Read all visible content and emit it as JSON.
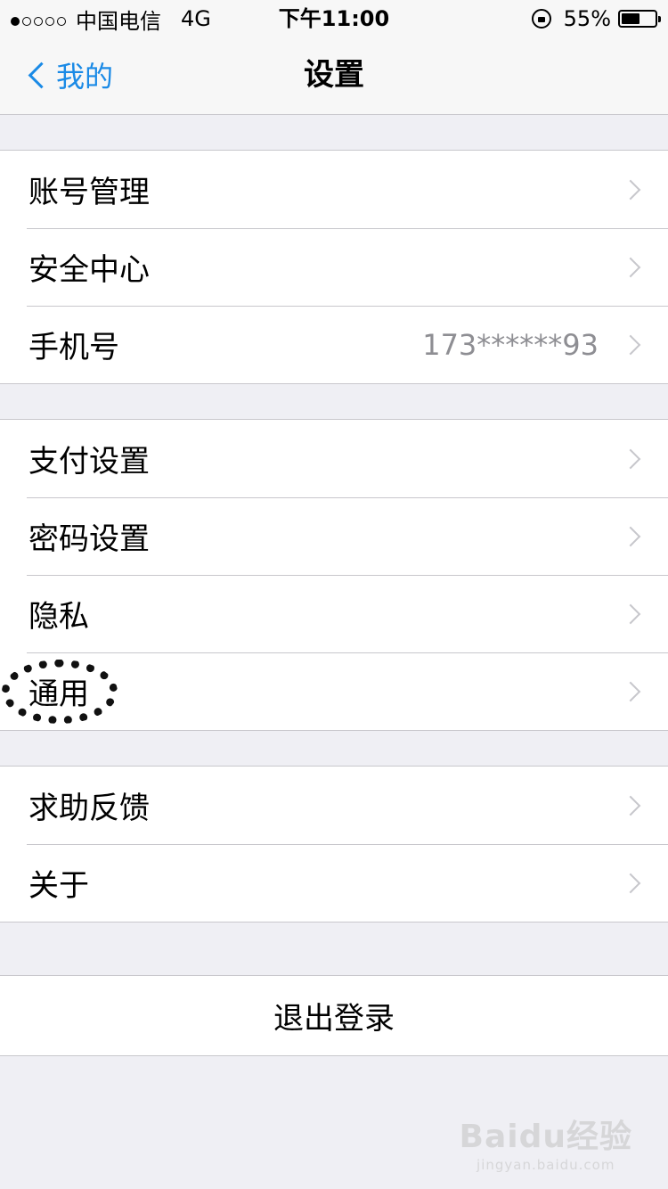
{
  "status_bar": {
    "carrier": "中国电信",
    "network": "4G",
    "time": "下午11:00",
    "battery_percent": "55%",
    "battery_level": 0.55,
    "icons": [
      "signal-dots-icon",
      "rotation-lock-icon",
      "battery-icon"
    ]
  },
  "nav": {
    "back_label": "我的",
    "title": "设置"
  },
  "groups": [
    {
      "rows": [
        {
          "label": "账号管理",
          "value": ""
        },
        {
          "label": "安全中心",
          "value": ""
        },
        {
          "label": "手机号",
          "value": "173******93"
        }
      ]
    },
    {
      "rows": [
        {
          "label": "支付设置",
          "value": ""
        },
        {
          "label": "密码设置",
          "value": ""
        },
        {
          "label": "隐私",
          "value": ""
        },
        {
          "label": "通用",
          "value": ""
        }
      ]
    },
    {
      "rows": [
        {
          "label": "求助反馈",
          "value": ""
        },
        {
          "label": "关于",
          "value": ""
        }
      ]
    }
  ],
  "logout_label": "退出登录",
  "watermark": {
    "logo": "Baidu经验",
    "url": "jingyan.baidu.com"
  },
  "colors": {
    "accent": "#1a8ae6",
    "background": "#efeff4",
    "separator": "#c8c7cc",
    "secondary_text": "#8e8e93"
  }
}
